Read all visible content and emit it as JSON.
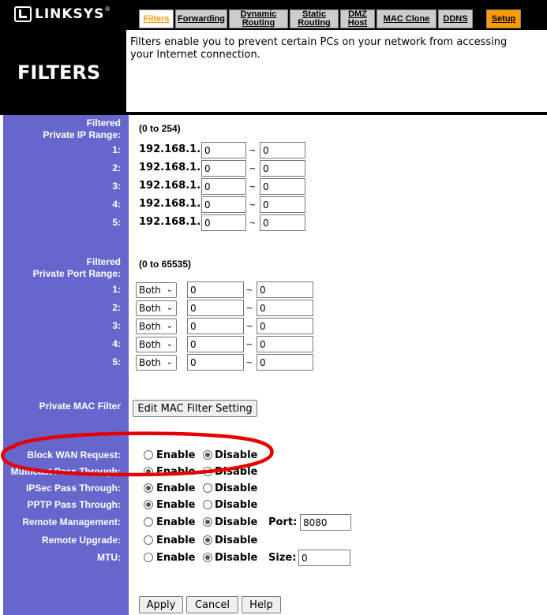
{
  "brand": {
    "logo_text": "LINKSYS",
    "reg_mark": "®"
  },
  "tabs": [
    {
      "label": "Filters"
    },
    {
      "label": "Forwarding"
    },
    {
      "label": "Dynamic Routing"
    },
    {
      "label": "Static Routing"
    },
    {
      "label": "DMZ Host"
    },
    {
      "label": "MAC Clone"
    },
    {
      "label": "DDNS"
    },
    {
      "label": "Setup"
    }
  ],
  "page": {
    "title": "FILTERS",
    "description": "Filters enable you to prevent certain PCs on your network from accessing your Internet connection."
  },
  "ip_filter": {
    "label_line1": "Filtered",
    "label_line2": "Private IP Range:",
    "range_note": "(0 to 254)",
    "prefix": "192.168.1.",
    "rows": [
      {
        "num": "1:",
        "from": "0",
        "to": "0"
      },
      {
        "num": "2:",
        "from": "0",
        "to": "0"
      },
      {
        "num": "3:",
        "from": "0",
        "to": "0"
      },
      {
        "num": "4:",
        "from": "0",
        "to": "0"
      },
      {
        "num": "5:",
        "from": "0",
        "to": "0"
      }
    ]
  },
  "port_filter": {
    "label_line1": "Filtered",
    "label_line2": "Private Port Range:",
    "range_note": "(0 to 65535)",
    "rows": [
      {
        "num": "1:",
        "protocol": "Both",
        "from": "0",
        "to": "0"
      },
      {
        "num": "2:",
        "protocol": "Both",
        "from": "0",
        "to": "0"
      },
      {
        "num": "3:",
        "protocol": "Both",
        "from": "0",
        "to": "0"
      },
      {
        "num": "4:",
        "protocol": "Both",
        "from": "0",
        "to": "0"
      },
      {
        "num": "5:",
        "protocol": "Both",
        "from": "0",
        "to": "0"
      }
    ]
  },
  "mac_filter": {
    "label": "Private MAC Filter",
    "button": "Edit MAC Filter Setting"
  },
  "options": {
    "enable_label": "Enable",
    "disable_label": "Disable",
    "rows": [
      {
        "label": "Block WAN Request:",
        "selected": "disable"
      },
      {
        "label": "Multicast Pass Through:",
        "selected": "enable"
      },
      {
        "label": "IPSec Pass Through:",
        "selected": "enable"
      },
      {
        "label": "PPTP Pass Through:",
        "selected": "enable"
      },
      {
        "label": "Remote Management:",
        "selected": "disable",
        "extra_label": "Port:",
        "extra_value": "8080"
      },
      {
        "label": "Remote Upgrade:",
        "selected": "disable"
      },
      {
        "label": "MTU:",
        "selected": "disable",
        "extra_label": "Size:",
        "extra_value": "0"
      }
    ]
  },
  "actions": {
    "apply": "Apply",
    "cancel": "Cancel",
    "help": "Help"
  },
  "colors": {
    "left_column": "#6666cc",
    "active_tab_text": "#ff9a00",
    "setup_tab": "#ff9a00",
    "annotation": "#e60000"
  }
}
